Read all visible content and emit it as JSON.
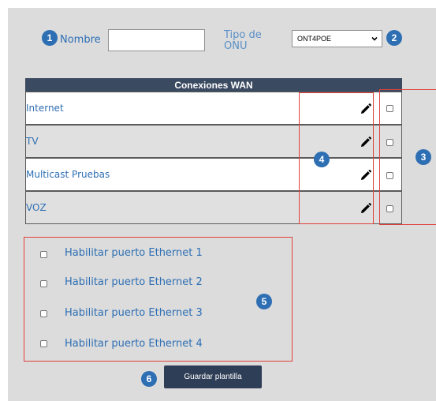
{
  "form": {
    "nombre_label": "Nombre",
    "nombre_value": "",
    "tipo_onu_label_line1": "Tipo de",
    "tipo_onu_label_line2": "ONU",
    "tipo_onu_selected": "ONT4POE"
  },
  "wan": {
    "header": "Conexiones WAN",
    "rows": [
      {
        "name": "Internet"
      },
      {
        "name": "TV"
      },
      {
        "name": "Multicast Pruebas"
      },
      {
        "name": "VOZ"
      }
    ]
  },
  "ethernet": {
    "ports": [
      {
        "label": "Habilitar puerto Ethernet  1"
      },
      {
        "label": "Habilitar puerto Ethernet  2"
      },
      {
        "label": "Habilitar puerto Ethernet  3"
      },
      {
        "label": "Habilitar puerto Ethernet  4"
      }
    ]
  },
  "actions": {
    "save_label": "Guardar plantilla"
  },
  "badges": {
    "b1": "1",
    "b2": "2",
    "b3": "3",
    "b4": "4",
    "b5": "5",
    "b6": "6"
  },
  "colors": {
    "accent": "#2e6fb4",
    "header_bg": "#3a4a60",
    "button_bg": "#2e3e56",
    "highlight_red": "#e0413a",
    "panel_bg": "#dcdcdc"
  }
}
